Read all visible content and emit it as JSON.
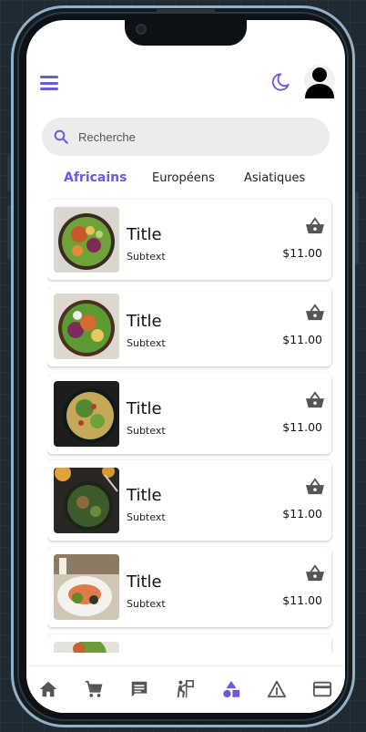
{
  "header": {
    "menu_icon": "menu-icon",
    "theme_icon": "moon-icon",
    "avatar_icon": "avatar"
  },
  "search": {
    "placeholder": "Recherche",
    "icon": "search-icon"
  },
  "tabs": [
    {
      "label": "Africains",
      "active": true
    },
    {
      "label": "Européens",
      "active": false
    },
    {
      "label": "Asiatiques",
      "active": false
    }
  ],
  "items": [
    {
      "title": "Title",
      "subtext": "Subtext",
      "price": "$11.00"
    },
    {
      "title": "Title",
      "subtext": "Subtext",
      "price": "$11.00"
    },
    {
      "title": "Title",
      "subtext": "Subtext",
      "price": "$11.00"
    },
    {
      "title": "Title",
      "subtext": "Subtext",
      "price": "$11.00"
    },
    {
      "title": "Title",
      "subtext": "Subtext",
      "price": "$11.00"
    },
    {
      "title": "",
      "subtext": "",
      "price": ""
    }
  ],
  "bottom_nav": [
    {
      "icon": "home-icon",
      "active": false
    },
    {
      "icon": "cart-icon",
      "active": false
    },
    {
      "icon": "chat-icon",
      "active": false
    },
    {
      "icon": "delivery-icon",
      "active": false
    },
    {
      "icon": "categories-icon",
      "active": true
    },
    {
      "icon": "warning-icon",
      "active": false
    },
    {
      "icon": "card-icon",
      "active": false
    }
  ],
  "colors": {
    "accent": "#6a5ae0",
    "icon_gray": "#555555",
    "search_bg": "#ececec"
  }
}
